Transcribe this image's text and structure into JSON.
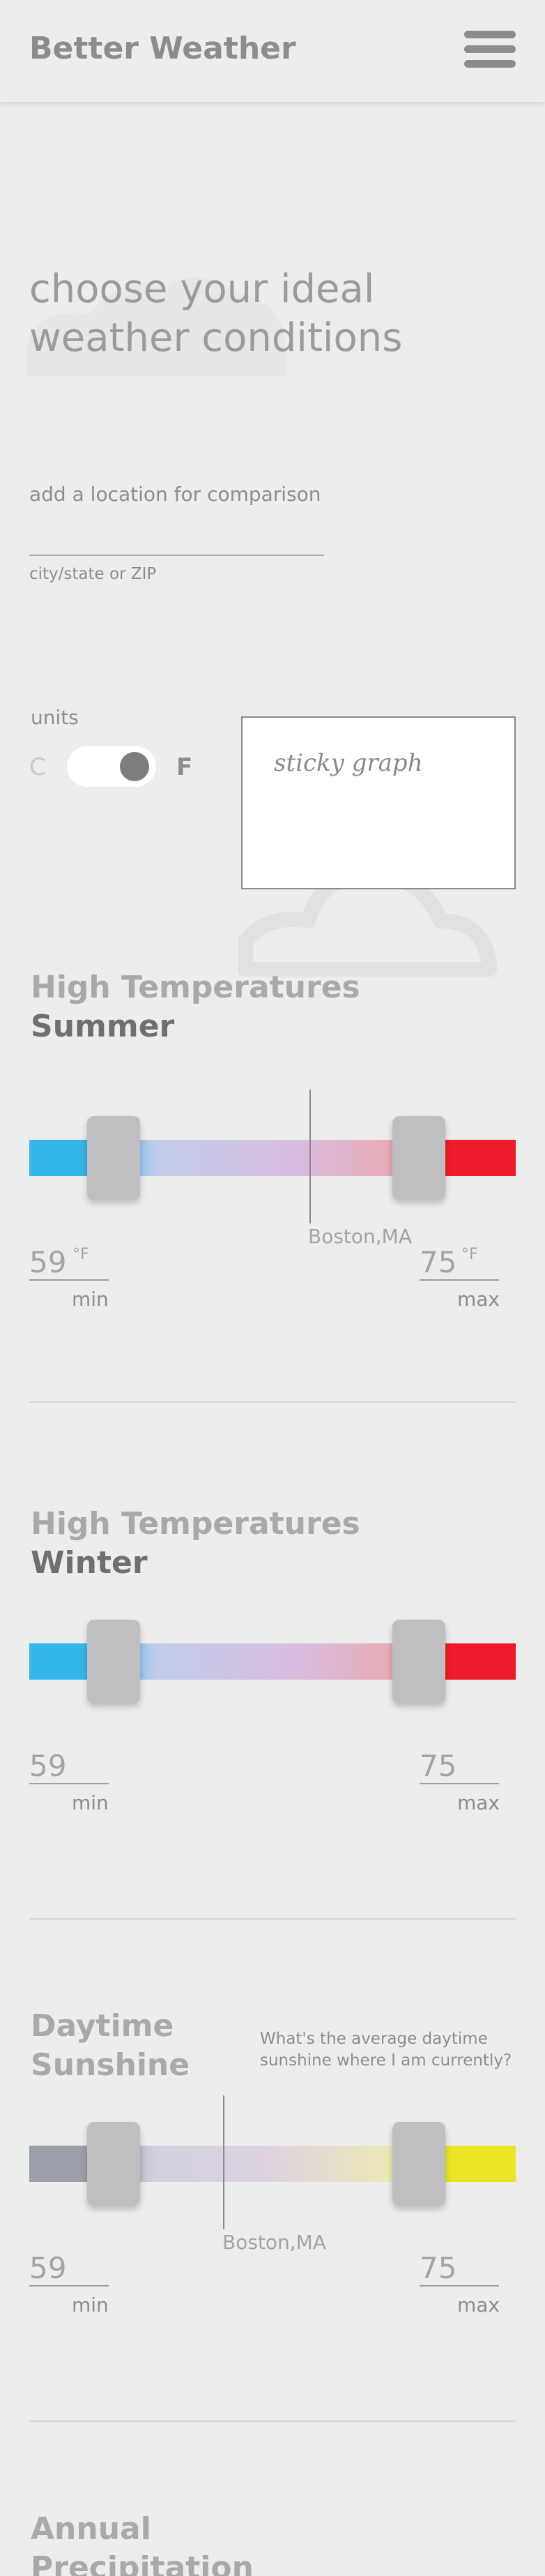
{
  "header": {
    "brand": "Better Weather",
    "menu_icon": "hamburger-menu-icon"
  },
  "hero": {
    "title": "choose your ideal weather conditions"
  },
  "location": {
    "label": "add a location for comparison",
    "value": "",
    "hint": "city/state or ZIP"
  },
  "units": {
    "label": "units",
    "celsius": "C",
    "fahrenheit": "F",
    "selected": "F"
  },
  "sticky": {
    "text": "sticky graph"
  },
  "sections": [
    {
      "title": "High Temperatures",
      "subtitle": "Summer",
      "min": "59",
      "max": "75",
      "unit": "°F",
      "min_label": "min",
      "max_label": "max",
      "marker_label": "Boston,MA",
      "colors": {
        "low": "#35b7ec",
        "high": "#ee1c2a"
      }
    },
    {
      "title": "High Temperatures",
      "subtitle": "Winter",
      "min": "59",
      "max": "75",
      "min_label": "min",
      "max_label": "max",
      "colors": {
        "low": "#35b7ec",
        "high": "#ee1c2a"
      }
    },
    {
      "title": "Daytime Sunshine",
      "question": "What's the average daytime sunshine where I am currently?",
      "min": "59",
      "max": "75",
      "min_label": "min",
      "max_label": "max",
      "marker_label": "Boston,MA",
      "colors": {
        "low": "#9c9faa",
        "high": "#e8e525"
      }
    },
    {
      "title": "Annual Precipitation"
    }
  ]
}
